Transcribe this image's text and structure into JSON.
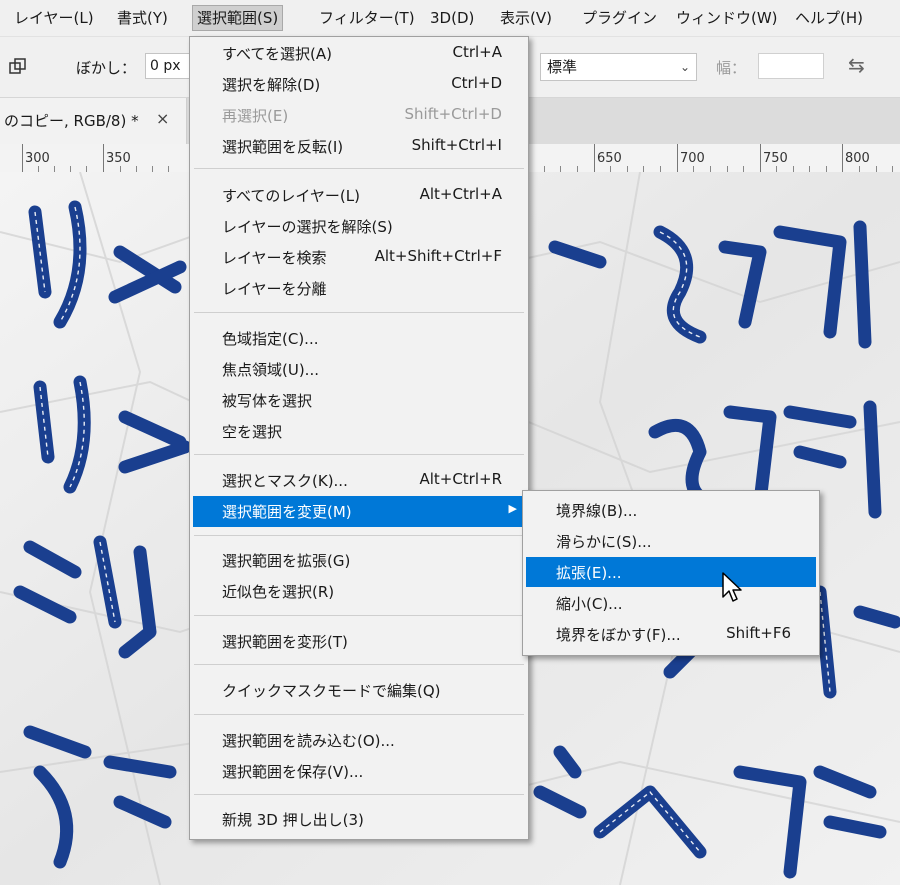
{
  "menubar": {
    "items": [
      {
        "label": "レイヤー(L)"
      },
      {
        "label": "書式(Y)"
      },
      {
        "label": "選択範囲(S)"
      },
      {
        "label": "フィルター(T)"
      },
      {
        "label": "3D(D)"
      },
      {
        "label": "表示(V)"
      },
      {
        "label": "プラグイン"
      },
      {
        "label": "ウィンドウ(W)"
      },
      {
        "label": "ヘルプ(H)"
      }
    ]
  },
  "options": {
    "feather_label": "ぼかし：",
    "feather_value": "0 px",
    "style_value": "標準",
    "width_label": "幅："
  },
  "document_tab": {
    "title": "のコピー, RGB/8) *",
    "close": "×"
  },
  "ruler": {
    "ticks": [
      "300",
      "350",
      "650",
      "700",
      "750",
      "800"
    ]
  },
  "select_menu": {
    "groups": [
      [
        {
          "label": "すべてを選択(A)",
          "shortcut": "Ctrl+A"
        },
        {
          "label": "選択を解除(D)",
          "shortcut": "Ctrl+D"
        },
        {
          "label": "再選択(E)",
          "shortcut": "Shift+Ctrl+D",
          "disabled": true
        },
        {
          "label": "選択範囲を反転(I)",
          "shortcut": "Shift+Ctrl+I"
        }
      ],
      [
        {
          "label": "すべてのレイヤー(L)",
          "shortcut": "Alt+Ctrl+A"
        },
        {
          "label": "レイヤーの選択を解除(S)",
          "shortcut": ""
        },
        {
          "label": "レイヤーを検索",
          "shortcut": "Alt+Shift+Ctrl+F"
        },
        {
          "label": "レイヤーを分離",
          "shortcut": ""
        }
      ],
      [
        {
          "label": "色域指定(C)...",
          "shortcut": ""
        },
        {
          "label": "焦点領域(U)...",
          "shortcut": ""
        },
        {
          "label": "被写体を選択",
          "shortcut": ""
        },
        {
          "label": "空を選択",
          "shortcut": ""
        }
      ],
      [
        {
          "label": "選択とマスク(K)...",
          "shortcut": "Alt+Ctrl+R"
        },
        {
          "label": "選択範囲を変更(M)",
          "shortcut": "",
          "highlighted": true,
          "submenu": true
        }
      ],
      [
        {
          "label": "選択範囲を拡張(G)",
          "shortcut": ""
        },
        {
          "label": "近似色を選択(R)",
          "shortcut": ""
        }
      ],
      [
        {
          "label": "選択範囲を変形(T)",
          "shortcut": ""
        }
      ],
      [
        {
          "label": "クイックマスクモードで編集(Q)",
          "shortcut": ""
        }
      ],
      [
        {
          "label": "選択範囲を読み込む(O)...",
          "shortcut": ""
        },
        {
          "label": "選択範囲を保存(V)...",
          "shortcut": ""
        }
      ],
      [
        {
          "label": "新規 3D 押し出し(3)",
          "shortcut": ""
        }
      ]
    ]
  },
  "modify_submenu": {
    "items": [
      {
        "label": "境界線(B)...",
        "shortcut": ""
      },
      {
        "label": "滑らかに(S)...",
        "shortcut": ""
      },
      {
        "label": "拡張(E)...",
        "shortcut": "",
        "highlighted": true
      },
      {
        "label": "縮小(C)...",
        "shortcut": ""
      },
      {
        "label": "境界をぼかす(F)...",
        "shortcut": "Shift+F6"
      }
    ]
  },
  "colors": {
    "highlight": "#0078d7",
    "ink": "#1a3f8f"
  }
}
